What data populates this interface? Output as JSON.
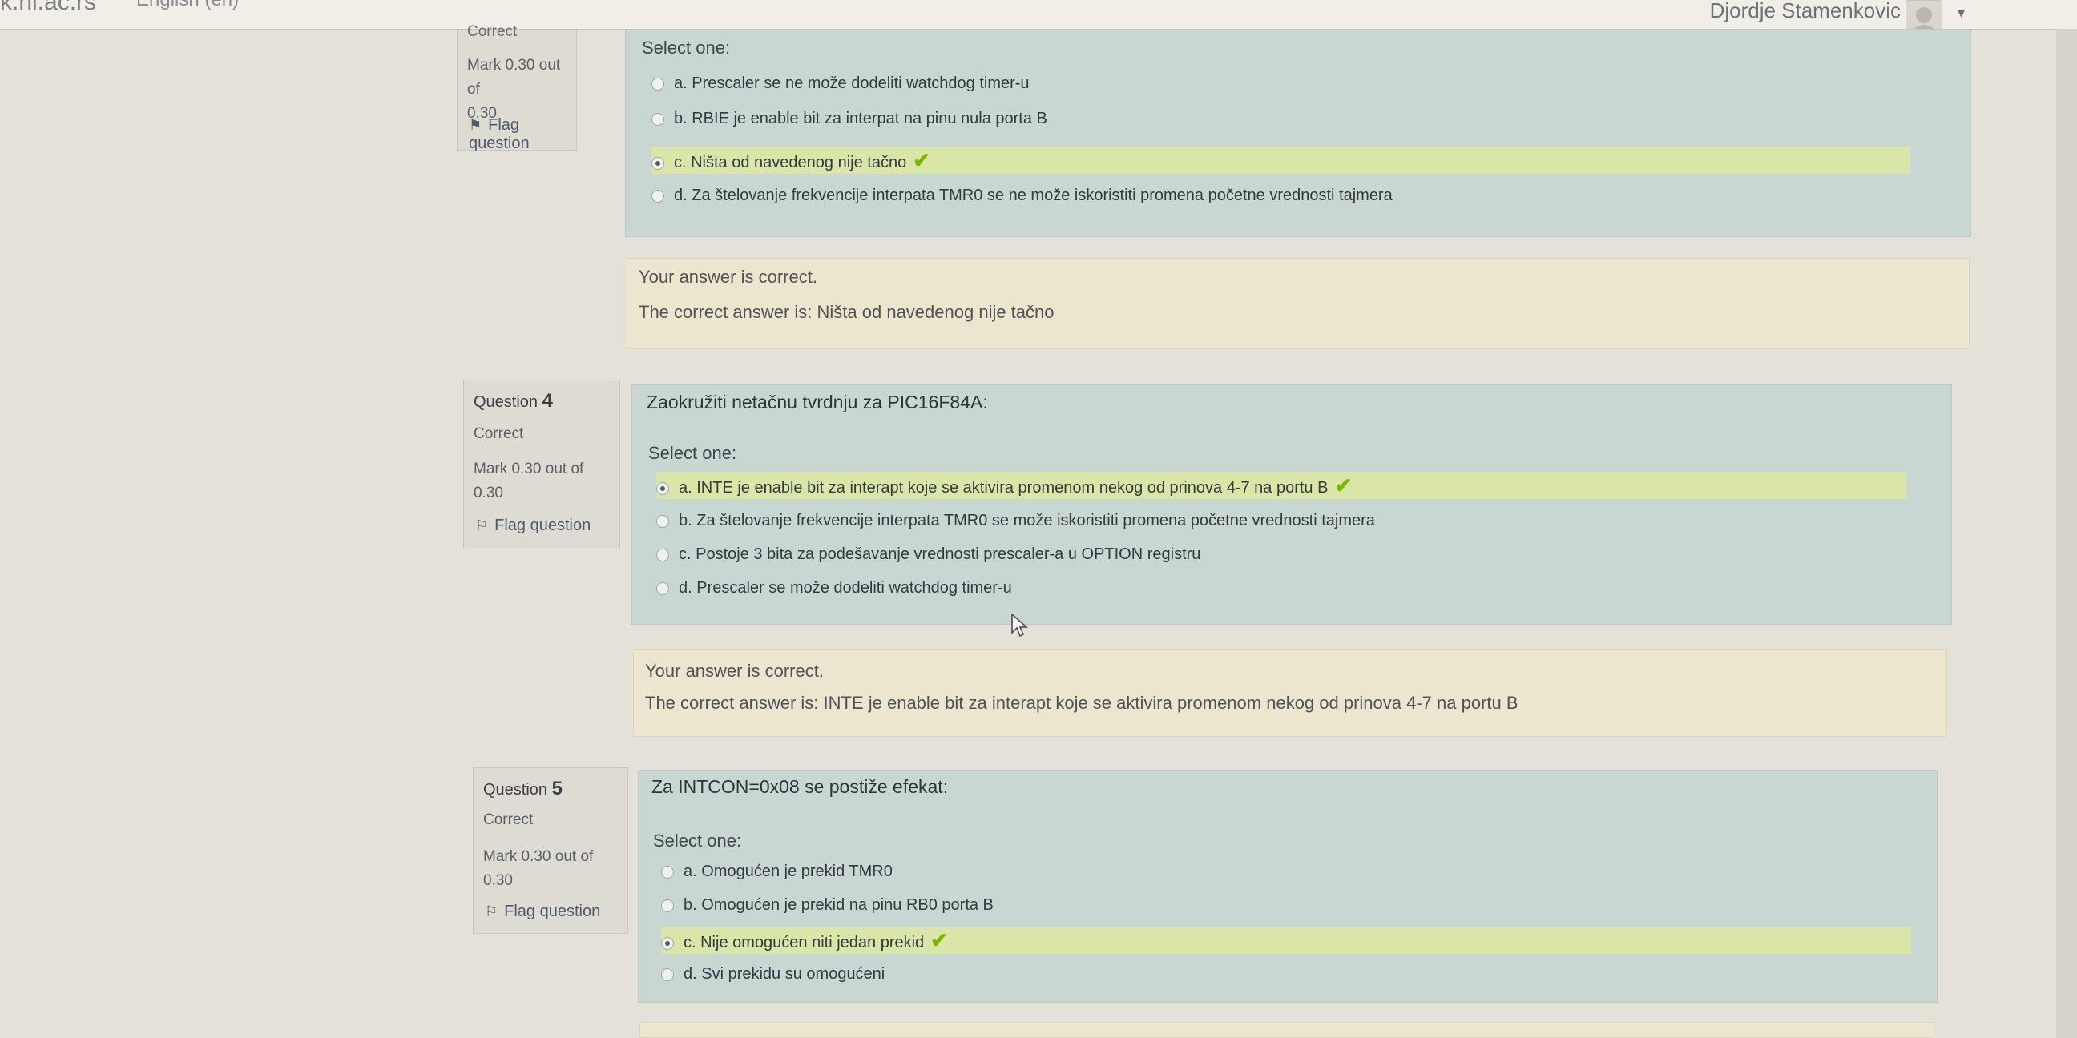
{
  "topbar": {
    "site_label": "k.ni.ac.rs",
    "language": "English (en)",
    "user_name": "Djordje Stamenkovic"
  },
  "q3": {
    "state": "Correct",
    "mark_line1": "Mark 0.30 out of",
    "mark_line2": "0.30",
    "flag_label": "Flag question",
    "prompt": "Select one:",
    "answers": [
      {
        "label": "a. Prescaler se ne može dodeliti watchdog timer-u",
        "selected": false,
        "correct": false
      },
      {
        "label": "b. RBIE je enable bit za interpat na pinu nula porta B",
        "selected": false,
        "correct": false
      },
      {
        "label": "c. Ništa od navedenog nije tačno",
        "selected": true,
        "correct": true
      },
      {
        "label": "d. Za štelovanje frekvencije interpata TMR0 se ne može iskoristiti promena početne vrednosti tajmera",
        "selected": false,
        "correct": false
      }
    ],
    "feedback_status": "Your answer is correct.",
    "feedback_correct": "The correct answer is: Ništa od navedenog nije tačno"
  },
  "q4": {
    "label_prefix": "Question",
    "number": "4",
    "state": "Correct",
    "mark_line1": "Mark 0.30 out of",
    "mark_line2": "0.30",
    "flag_label": "Flag question",
    "question_text": "Zaokružiti netačnu tvrdnju za PIC16F84A:",
    "prompt": "Select one:",
    "answers": [
      {
        "label": "a. INTE je enable bit za interapt koje se aktivira promenom nekog od prinova 4-7 na portu B",
        "selected": true,
        "correct": true
      },
      {
        "label": "b. Za štelovanje frekvencije interpata TMR0 se može iskoristiti promena početne vrednosti tajmera",
        "selected": false,
        "correct": false
      },
      {
        "label": "c. Postoje 3 bita za podešavanje vrednosti prescaler-a u OPTION registru",
        "selected": false,
        "correct": false
      },
      {
        "label": "d. Prescaler se može dodeliti watchdog timer-u",
        "selected": false,
        "correct": false
      }
    ],
    "feedback_status": "Your answer is correct.",
    "feedback_correct": "The correct answer is: INTE je enable bit za interapt koje se aktivira promenom nekog od prinova 4-7 na portu B"
  },
  "q5": {
    "label_prefix": "Question",
    "number": "5",
    "state": "Correct",
    "mark_line1": "Mark 0.30 out of",
    "mark_line2": "0.30",
    "flag_label": "Flag question",
    "question_text": "Za INTCON=0x08 se postiže efekat:",
    "prompt": "Select one:",
    "answers": [
      {
        "label": "a. Omogućen je prekid TMR0",
        "selected": false,
        "correct": false
      },
      {
        "label": "b. Omogućen je prekid na pinu RB0 porta B",
        "selected": false,
        "correct": false
      },
      {
        "label": "c. Nije omogućen niti jedan prekid",
        "selected": true,
        "correct": true
      },
      {
        "label": "d. Svi prekidu su omogućeni",
        "selected": false,
        "correct": false
      }
    ]
  },
  "colors": {
    "formulation_bg": "#c9d7d3",
    "feedback_bg": "#ece6ce",
    "correct_highlight": "#d9e6a8",
    "tick": "#7ab800"
  },
  "icons": [
    "flag-icon",
    "tick-icon",
    "avatar-icon",
    "caret-down-icon",
    "cursor-arrow-icon"
  ]
}
